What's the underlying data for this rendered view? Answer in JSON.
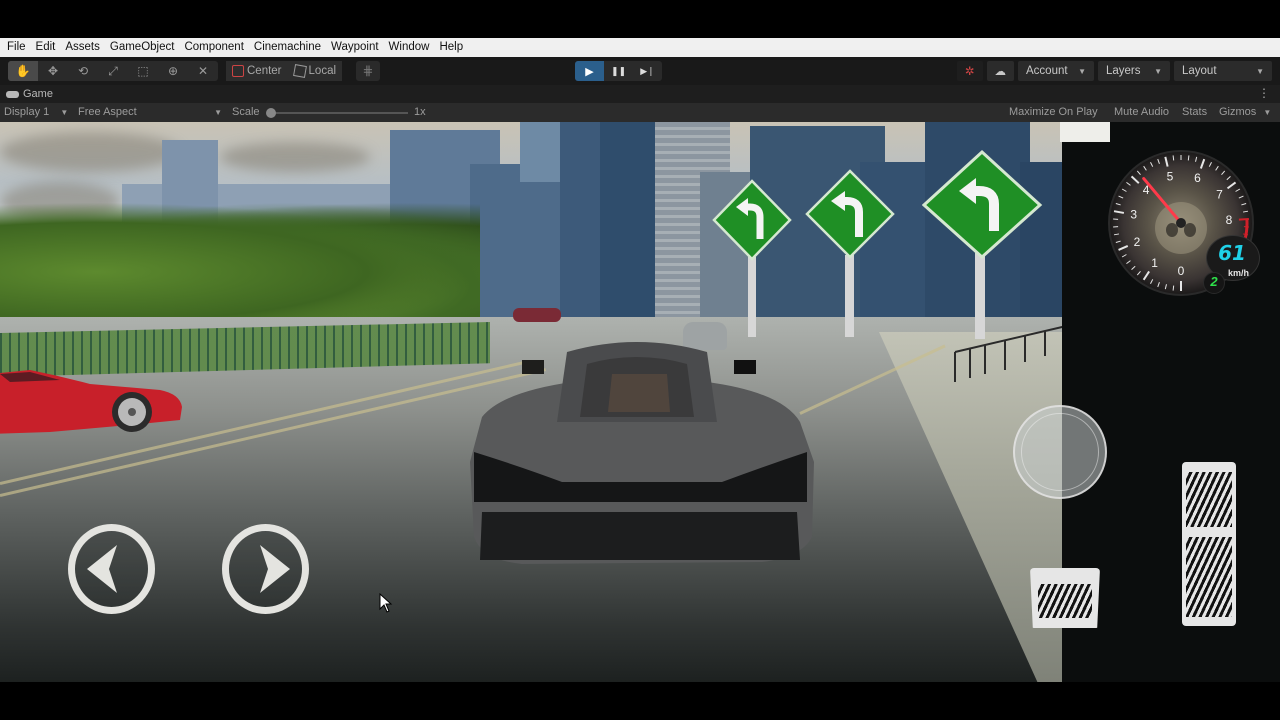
{
  "menubar": {
    "items": [
      "File",
      "Edit",
      "Assets",
      "GameObject",
      "Component",
      "Cinemachine",
      "Waypoint",
      "Window",
      "Help"
    ]
  },
  "toolbar": {
    "tools": [
      {
        "name": "hand-tool",
        "icon": "hand-icon",
        "glyph": "✋",
        "active": true
      },
      {
        "name": "move-tool",
        "icon": "move-icon",
        "glyph": "✥",
        "active": false
      },
      {
        "name": "rotate-tool",
        "icon": "rotate-icon",
        "glyph": "⟲",
        "active": false
      },
      {
        "name": "scale-tool",
        "icon": "scale-icon",
        "glyph": "⤢",
        "active": false
      },
      {
        "name": "rect-tool",
        "icon": "rect-icon",
        "glyph": "⬚",
        "active": false
      },
      {
        "name": "transform-tool",
        "icon": "transform-icon",
        "glyph": "⊕",
        "active": false
      },
      {
        "name": "custom-tool",
        "icon": "tools-icon",
        "glyph": "✕",
        "active": false
      }
    ],
    "pivot_label": "Center",
    "rotation_label": "Local",
    "grid_snap_glyph": "⋕",
    "play_label": "▶",
    "pause_label": "❚❚",
    "step_label": "▶❘",
    "collab_glyph": "✲",
    "cloud_glyph": "☁",
    "account_label": "Account",
    "layers_label": "Layers",
    "layout_label": "Layout",
    "caret": "▼"
  },
  "game_tab": {
    "label": "Game",
    "kebab": "⋮"
  },
  "gamebar": {
    "display": "Display 1",
    "aspect": "Free Aspect",
    "scale_label": "Scale",
    "scale_value": "1x",
    "maximize_on_play": "Maximize On Play",
    "mute_audio": "Mute Audio",
    "stats": "Stats",
    "gizmos": "Gizmos",
    "caret": "▼"
  },
  "hud": {
    "speed": "61",
    "speed_unit": "km/h",
    "gear": "2",
    "rpm_ticks": [
      "0",
      "1",
      "2",
      "3",
      "4",
      "5",
      "6",
      "7",
      "8",
      "9"
    ],
    "rpm_needle_value": 4.2,
    "redline_start": 8,
    "steer_left_glyph": "◀",
    "steer_right_glyph": "▶"
  },
  "scene": {
    "road_signs": 3,
    "sign_color": "#1f8f25",
    "red_car_color": "#c8202a",
    "player_car_color": "#3d3f40"
  },
  "colors": {
    "menubar_bg": "#f0f0f0",
    "toolbar_bg": "#191919",
    "play_active": "#2b5f8c",
    "speed_text": "#1fd1e8",
    "gear_text": "#2ee04a",
    "redline": "#d0202a"
  }
}
